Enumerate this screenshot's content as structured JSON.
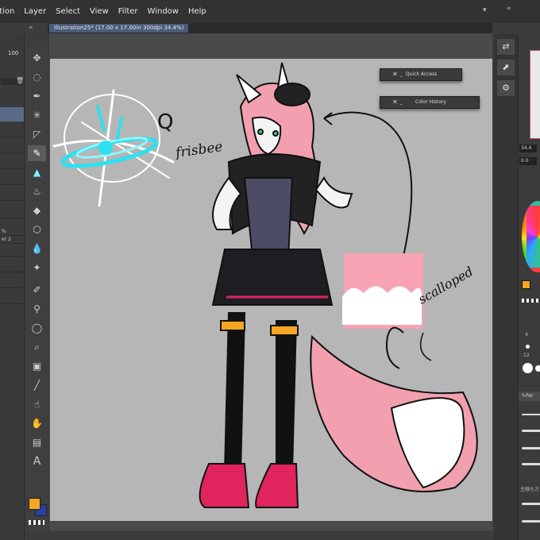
{
  "menu": {
    "items": [
      "ation",
      "Layer",
      "Select",
      "View",
      "Filter",
      "Window",
      "Help"
    ]
  },
  "document_tab": {
    "title": "Illustration25* (17.00 x 17.00in 300dpi 34.4%)"
  },
  "left_panel": {
    "opacity": "100",
    "rows": [
      "%",
      "er 2",
      "",
      "",
      "",
      ""
    ]
  },
  "floating_panels": [
    {
      "title": "Quick Access"
    },
    {
      "title": "Color History"
    }
  ],
  "annotations": {
    "q": "Q",
    "frisbee": "frisbee",
    "scalloped": "scalloped"
  },
  "right_panel": {
    "value_a": "34.4",
    "value_b": "0.0",
    "brush_size_a": "4",
    "brush_size_b": "12",
    "brush_label": "Per",
    "jp_label": "主線も方"
  },
  "colors": {
    "main_color": "#f5a623",
    "sub_color": "#2b3ea8",
    "accent_tab": "#4a5c7a",
    "hair_pink": "#f2a0b0",
    "frisbee_cyan": "#2fe0f0"
  },
  "toolbar": {
    "tools": [
      "move-icon",
      "lasso-select-icon",
      "eyedropper-icon",
      "sparkle-icon",
      "shape-icon",
      "pen-icon",
      "paint-icon",
      "bucket-icon",
      "fill-icon",
      "eraser-icon",
      "blend-icon",
      "decorate-icon",
      "pen-alt-icon",
      "marker-icon",
      "lasso-icon",
      "zoom-icon",
      "gradient-icon",
      "line-icon",
      "operation-icon",
      "hand-icon",
      "frame-icon",
      "text-icon"
    ]
  }
}
